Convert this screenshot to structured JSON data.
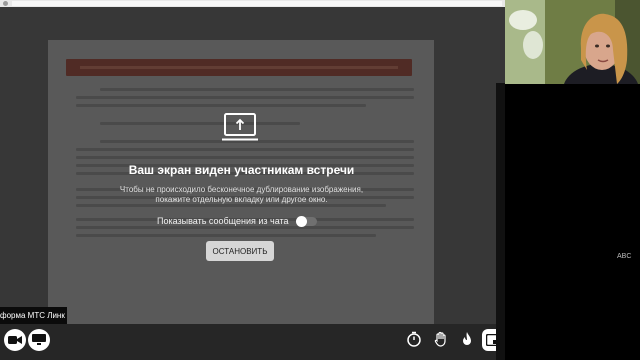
{
  "share_overlay": {
    "title": "Ваш экран виден участникам встречи",
    "description_line1": "Чтобы не происходило бесконечное дублирование изображения,",
    "description_line2": "покажите отдельную вкладку или другое окно.",
    "chat_toggle_label": "Показывать сообщения из чата",
    "chat_toggle_on": false,
    "stop_button_label": "ОСТАНОВИТЬ"
  },
  "platform_tag": "форма МТС Линк",
  "participant_tile_label": "ABC",
  "toolbar": {
    "left_buttons": [
      "camera-icon",
      "screen-share-icon"
    ],
    "right_buttons": [
      "timer-icon",
      "raise-hand-icon",
      "fire-icon",
      "fullscreen-icon"
    ]
  },
  "colors": {
    "background": "#262626",
    "stop_button_bg": "#d6d6d6",
    "doc_title_band": "#5b1c12"
  }
}
